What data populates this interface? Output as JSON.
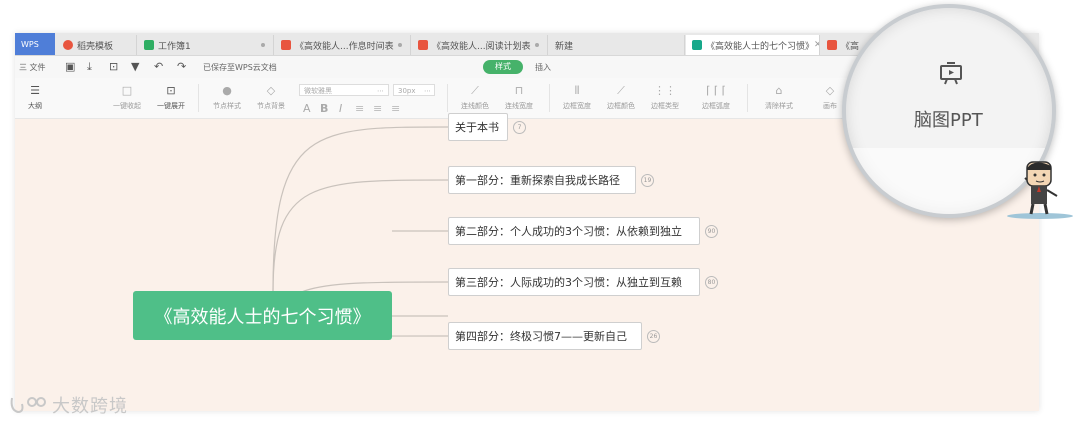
{
  "tabs": [
    {
      "label": "WPS"
    },
    {
      "label": "稻壳模板",
      "color": "#e8553f"
    },
    {
      "label": "工作簿1",
      "color": "#2fae63"
    },
    {
      "label": "《高效能人...作息时间表",
      "color": "#e8553f"
    },
    {
      "label": "《高效能人...阅读计划表",
      "color": "#e8553f"
    },
    {
      "label": "新建"
    },
    {
      "label": "《高效能人士的七个习惯》",
      "color": "#17a88a"
    },
    {
      "label": "《高",
      "color": "#e8553f"
    }
  ],
  "menu": {
    "file": "三 文件",
    "save_status": "已保存至WPS云文档",
    "style_tab": "样式",
    "insert_tab": "插入"
  },
  "toolbar": {
    "outline": "大纲",
    "collapse": "一键收起",
    "expand": "一键展开",
    "node_style": "节点样式",
    "node_bg": "节点背景",
    "font_name": "微软雅黑",
    "font_size": "30px",
    "bold": "B",
    "italic": "I",
    "a": "A",
    "line_color": "连线颜色",
    "line_width": "连线宽度",
    "border_width": "边框宽度",
    "border_color": "边框颜色",
    "border_type": "边框类型",
    "border_radius": "边框弧度",
    "clear_style": "清除样式",
    "canvas": "画布"
  },
  "mindmap": {
    "root": "《高效能人士的七个习惯》",
    "branches": [
      {
        "label": "关于本书",
        "badge": "7"
      },
      {
        "label": "第一部分：重新探索自我成长路径",
        "badge": "19"
      },
      {
        "label": "第二部分：个人成功的3个习惯：从依赖到独立",
        "badge": "90"
      },
      {
        "label": "第三部分：人际成功的3个习惯：从独立到互赖",
        "badge": "80"
      },
      {
        "label": "第四部分：终极习惯7——更新自己",
        "badge": "26"
      }
    ],
    "line_color": "#c9c2bc",
    "root_color": "#4fbf88"
  },
  "magnifier": {
    "label": "脑图PPT"
  },
  "watermark": {
    "text": "大数跨境"
  }
}
